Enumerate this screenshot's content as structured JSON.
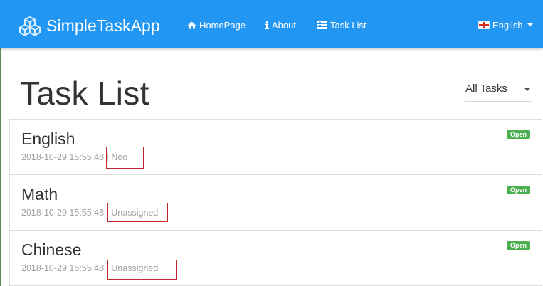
{
  "navbar": {
    "brand": "SimpleTaskApp",
    "brand_icon": "cubes-icon",
    "items": [
      {
        "label": "HomePage",
        "icon": "home-icon"
      },
      {
        "label": "About",
        "icon": "info-icon"
      },
      {
        "label": "Task List",
        "icon": "list-icon"
      }
    ],
    "language": {
      "label": "English",
      "icon": "flag-england-icon"
    }
  },
  "page": {
    "title": "Task List",
    "filter": {
      "selected": "All Tasks"
    }
  },
  "tasks": [
    {
      "title": "English",
      "date": "2018-10-29 15:55:48",
      "assignee": "Neo",
      "state": "Open"
    },
    {
      "title": "Math",
      "date": "2018-10-29 15:55:48",
      "assignee": "Unassigned",
      "state": "Open"
    },
    {
      "title": "Chinese",
      "date": "2018-10-29 15:55:48",
      "assignee": "Unassigned",
      "state": "Open"
    }
  ],
  "colors": {
    "navbar": "#2196f3",
    "badge": "#4caf50",
    "highlight": "#c0282d"
  }
}
